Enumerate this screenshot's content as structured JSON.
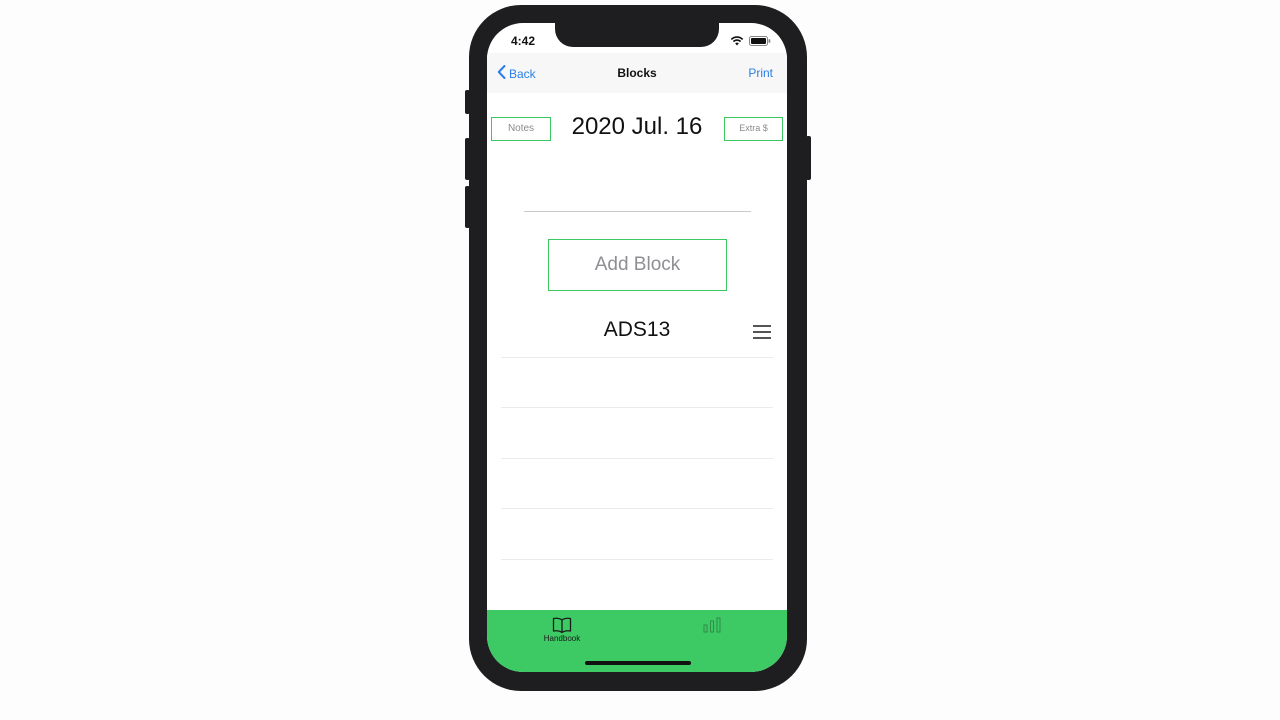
{
  "status_bar": {
    "time": "4:42"
  },
  "navbar": {
    "back_label": "Back",
    "title": "Blocks",
    "print_label": "Print"
  },
  "header": {
    "notes_label": "Notes",
    "date": "2020 Jul. 16",
    "extra_label": "Extra $"
  },
  "add_block_label": "Add Block",
  "blocks": [
    {
      "name": "ADS13"
    }
  ],
  "tabbar": {
    "active_color": "#3dca64",
    "tabs": [
      {
        "label": "Handbook",
        "icon": "book-icon"
      },
      {
        "label": "",
        "icon": "chart-icon"
      }
    ]
  },
  "colors": {
    "accent": "#3cc964",
    "link": "#2b7fe6"
  }
}
